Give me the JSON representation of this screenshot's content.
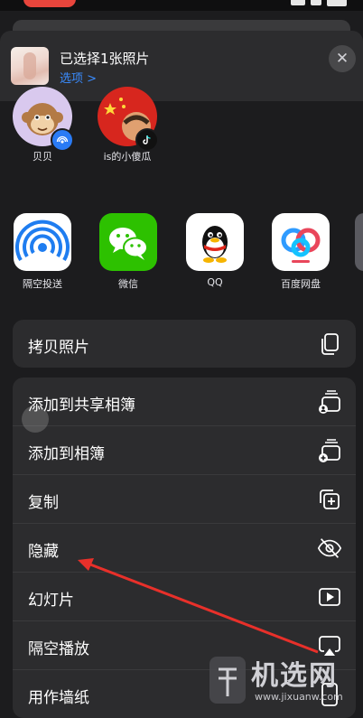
{
  "header": {
    "title": "已选择1张照片",
    "options_link": "选项 >"
  },
  "contacts": [
    {
      "name": "贝贝",
      "avatar": "monkey-avatar",
      "badge": "airdrop-icon"
    },
    {
      "name": "is的小傻瓜",
      "avatar": "flag-avatar",
      "badge": "tiktok-icon"
    }
  ],
  "apps": [
    {
      "label": "隔空投送",
      "icon": "airdrop-icon"
    },
    {
      "label": "微信",
      "icon": "wechat-icon"
    },
    {
      "label": "QQ",
      "icon": "qq-penguin-icon"
    },
    {
      "label": "百度网盘",
      "icon": "baidu-netdisk-icon"
    }
  ],
  "actions_top": [
    {
      "label": "拷贝照片",
      "icon": "copy-photo-icon"
    }
  ],
  "actions_main": [
    {
      "label": "添加到共享相簿",
      "icon": "shared-album-icon"
    },
    {
      "label": "添加到相簿",
      "icon": "add-album-icon"
    },
    {
      "label": "复制",
      "icon": "duplicate-icon"
    },
    {
      "label": "隐藏",
      "icon": "hide-eye-icon"
    },
    {
      "label": "幻灯片",
      "icon": "slideshow-play-icon"
    },
    {
      "label": "隔空播放",
      "icon": "airplay-icon"
    },
    {
      "label": "用作墙纸",
      "icon": "wallpaper-icon"
    }
  ],
  "watermark": {
    "brand": "机选网",
    "url": "www.jixuanw.com"
  },
  "colors": {
    "accent": "#3a8cff",
    "annotation": "#e8302a",
    "sheet": "#1c1c1e",
    "group": "#2c2c2e"
  }
}
